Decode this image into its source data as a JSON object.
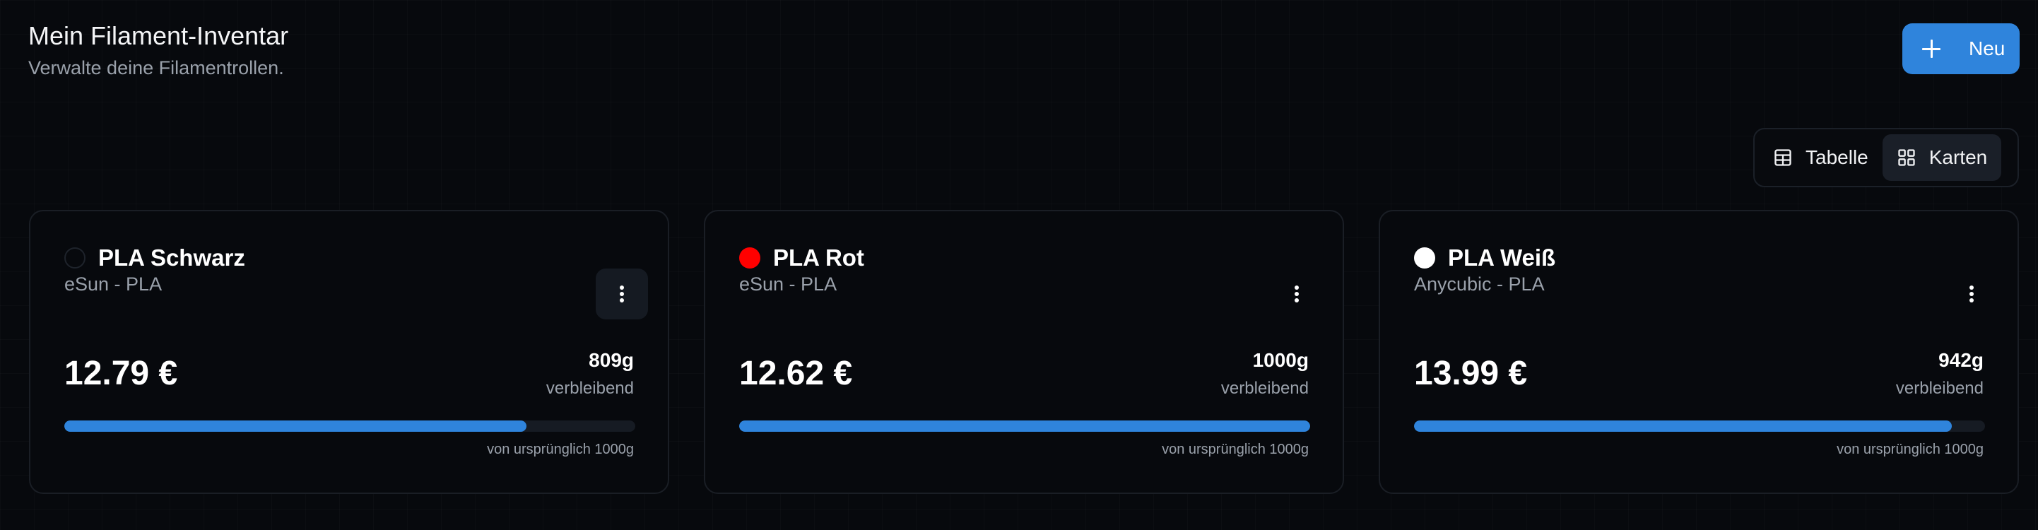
{
  "header": {
    "title": "Mein Filament-Inventar",
    "subtitle": "Verwalte deine Filamentrollen."
  },
  "actions": {
    "new_label": "Neu",
    "new_icon": "plus-icon"
  },
  "view_toggle": {
    "options": [
      {
        "label": "Tabelle",
        "icon": "table-icon",
        "active": false
      },
      {
        "label": "Karten",
        "icon": "grid-icon",
        "active": true
      }
    ]
  },
  "colors": {
    "accent": "#2f84dc",
    "background": "#07090d",
    "muted_text": "#9aa1ab"
  },
  "cards": [
    {
      "name": "PLA Schwarz",
      "swatch_color": "#000000",
      "brand_type": "eSun - PLA",
      "price": "12.79 €",
      "remaining": "809g",
      "remaining_label": "verbleibend",
      "remaining_fraction": 0.809,
      "original_text": "von ursprünglich 1000g"
    },
    {
      "name": "PLA Rot",
      "swatch_color": "#ff0000",
      "brand_type": "eSun - PLA",
      "price": "12.62 €",
      "remaining": "1000g",
      "remaining_label": "verbleibend",
      "remaining_fraction": 1.0,
      "original_text": "von ursprünglich 1000g"
    },
    {
      "name": "PLA Weiß",
      "swatch_color": "#ffffff",
      "brand_type": "Anycubic - PLA",
      "price": "13.99 €",
      "remaining": "942g",
      "remaining_label": "verbleibend",
      "remaining_fraction": 0.942,
      "original_text": "von ursprünglich 1000g"
    }
  ]
}
